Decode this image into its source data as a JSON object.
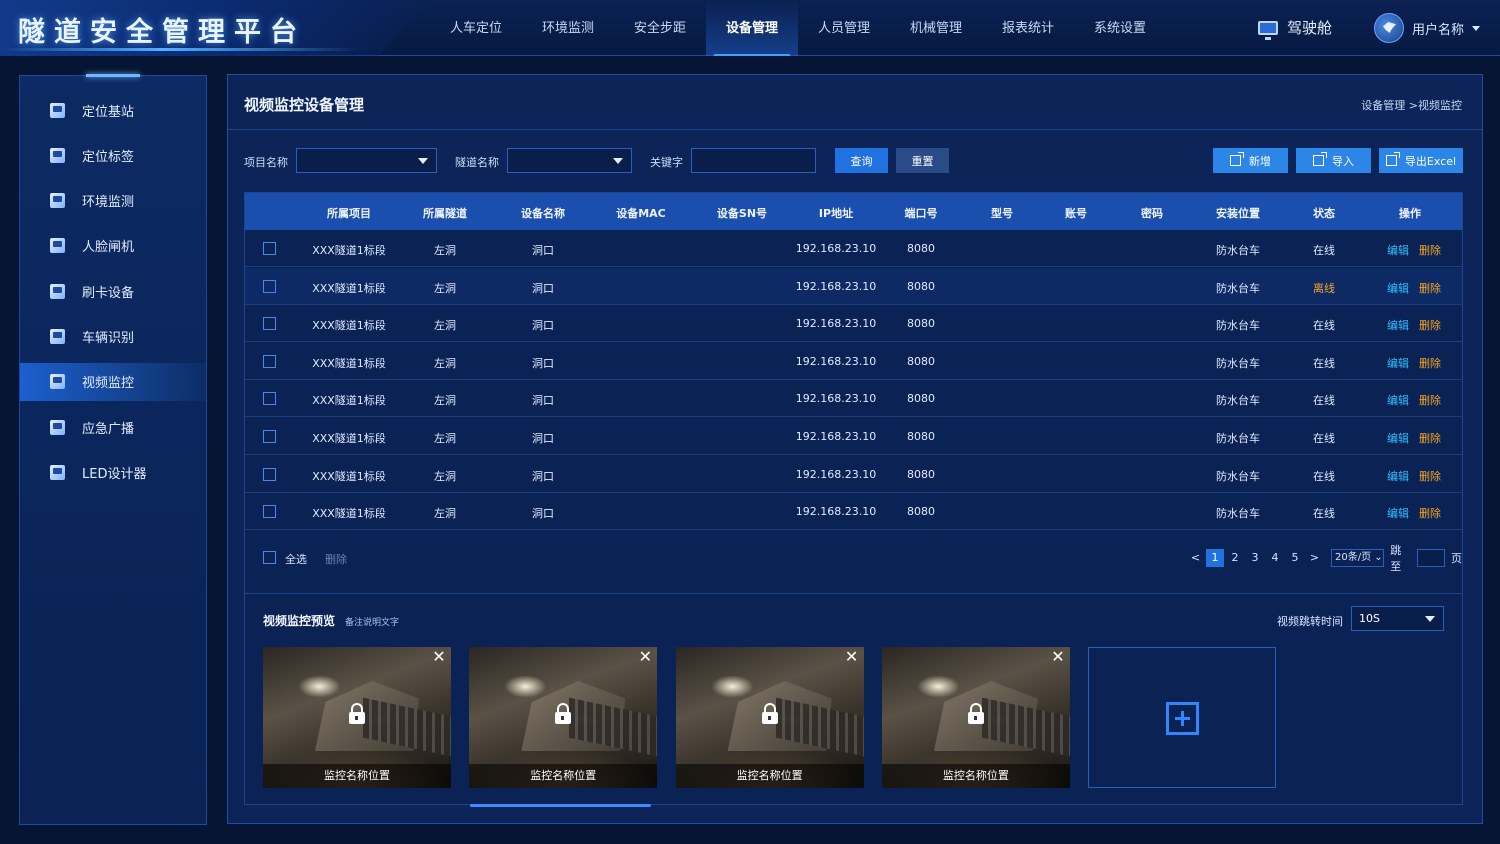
{
  "app": {
    "title": "隧道安全管理平台"
  },
  "nav": [
    {
      "label": "人车定位",
      "active": false
    },
    {
      "label": "环境监测",
      "active": false
    },
    {
      "label": "安全步距",
      "active": false
    },
    {
      "label": "设备管理",
      "active": true
    },
    {
      "label": "人员管理",
      "active": false
    },
    {
      "label": "机械管理",
      "active": false
    },
    {
      "label": "报表统计",
      "active": false
    },
    {
      "label": "系统设置",
      "active": false
    }
  ],
  "cockpit": {
    "label": "驾驶舱",
    "icon": "monitor-icon"
  },
  "user": {
    "name": "用户名称",
    "icon": "avatar-icon"
  },
  "sidebar": {
    "items": [
      {
        "label": "定位基站",
        "icon": "base-station-icon",
        "active": false
      },
      {
        "label": "定位标签",
        "icon": "tag-icon",
        "active": false
      },
      {
        "label": "环境监测",
        "icon": "environment-icon",
        "active": false
      },
      {
        "label": "人脸闸机",
        "icon": "face-gate-icon",
        "active": false
      },
      {
        "label": "刷卡设备",
        "icon": "card-reader-icon",
        "active": false
      },
      {
        "label": "车辆识别",
        "icon": "vehicle-icon",
        "active": false
      },
      {
        "label": "视频监控",
        "icon": "camera-icon",
        "active": true
      },
      {
        "label": "应急广播",
        "icon": "broadcast-icon",
        "active": false
      },
      {
        "label": "LED设计器",
        "icon": "led-icon",
        "active": false
      }
    ]
  },
  "page": {
    "title": "视频监控设备管理",
    "breadcrumb": "设备管理 >视频监控"
  },
  "filters": {
    "project_label": "项目名称",
    "project_value": "",
    "tunnel_label": "隧道名称",
    "tunnel_value": "",
    "keyword_label": "关键字",
    "keyword_value": "",
    "query_label": "查询",
    "reset_label": "重置",
    "add_label": "新增",
    "import_label": "导入",
    "export_label": "导出Excel"
  },
  "table": {
    "headers": [
      "所属项目",
      "所属隧道",
      "设备名称",
      "设备MAC",
      "设备SN号",
      "IP地址",
      "端口号",
      "型号",
      "账号",
      "密码",
      "安装位置",
      "状态",
      "操作"
    ],
    "edit_label": "编辑",
    "delete_label": "删除",
    "rows": [
      {
        "project": "XXX隧道1标段",
        "tunnel": "左洞",
        "name": "洞口",
        "mac": "",
        "sn": "",
        "ip": "192.168.23.10",
        "port": "8080",
        "model": "",
        "account": "",
        "password": "",
        "location": "防水台车",
        "status": "在线",
        "offline": false
      },
      {
        "project": "XXX隧道1标段",
        "tunnel": "左洞",
        "name": "洞口",
        "mac": "",
        "sn": "",
        "ip": "192.168.23.10",
        "port": "8080",
        "model": "",
        "account": "",
        "password": "",
        "location": "防水台车",
        "status": "离线",
        "offline": true
      },
      {
        "project": "XXX隧道1标段",
        "tunnel": "左洞",
        "name": "洞口",
        "mac": "",
        "sn": "",
        "ip": "192.168.23.10",
        "port": "8080",
        "model": "",
        "account": "",
        "password": "",
        "location": "防水台车",
        "status": "在线",
        "offline": false
      },
      {
        "project": "XXX隧道1标段",
        "tunnel": "左洞",
        "name": "洞口",
        "mac": "",
        "sn": "",
        "ip": "192.168.23.10",
        "port": "8080",
        "model": "",
        "account": "",
        "password": "",
        "location": "防水台车",
        "status": "在线",
        "offline": false
      },
      {
        "project": "XXX隧道1标段",
        "tunnel": "左洞",
        "name": "洞口",
        "mac": "",
        "sn": "",
        "ip": "192.168.23.10",
        "port": "8080",
        "model": "",
        "account": "",
        "password": "",
        "location": "防水台车",
        "status": "在线",
        "offline": false
      },
      {
        "project": "XXX隧道1标段",
        "tunnel": "左洞",
        "name": "洞口",
        "mac": "",
        "sn": "",
        "ip": "192.168.23.10",
        "port": "8080",
        "model": "",
        "account": "",
        "password": "",
        "location": "防水台车",
        "status": "在线",
        "offline": false
      },
      {
        "project": "XXX隧道1标段",
        "tunnel": "左洞",
        "name": "洞口",
        "mac": "",
        "sn": "",
        "ip": "192.168.23.10",
        "port": "8080",
        "model": "",
        "account": "",
        "password": "",
        "location": "防水台车",
        "status": "在线",
        "offline": false
      },
      {
        "project": "XXX隧道1标段",
        "tunnel": "左洞",
        "name": "洞口",
        "mac": "",
        "sn": "",
        "ip": "192.168.23.10",
        "port": "8080",
        "model": "",
        "account": "",
        "password": "",
        "location": "防水台车",
        "status": "在线",
        "offline": false
      }
    ],
    "select_all_label": "全选",
    "bulk_delete_label": "删除"
  },
  "pagination": {
    "prev": "<",
    "next": ">",
    "pages": [
      "1",
      "2",
      "3",
      "4",
      "5"
    ],
    "current": "1",
    "page_size": "20条/页",
    "jump_label": "跳至",
    "page_unit": "页",
    "jump_value": ""
  },
  "preview": {
    "title": "视频监控预览",
    "note": "备注说明文字",
    "interval_label": "视频跳转时间",
    "interval_value": "10S",
    "cameras": [
      {
        "caption": "监控名称位置"
      },
      {
        "caption": "监控名称位置"
      },
      {
        "caption": "监控名称位置"
      },
      {
        "caption": "监控名称位置"
      }
    ],
    "close_glyph": "✕"
  },
  "colors": {
    "accent": "#2072e0",
    "edit": "#2fc0ff",
    "delete": "#f5a623",
    "offline": "#f5a623",
    "background": "#061533"
  }
}
